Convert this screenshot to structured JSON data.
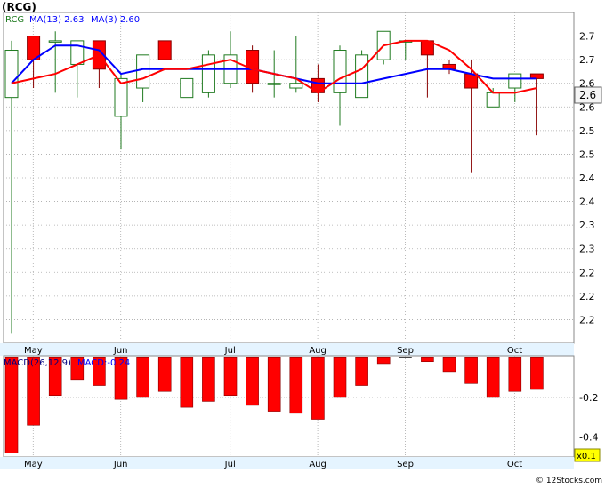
{
  "ticker_label": "(RCG)",
  "footer_credit": "© 12Stocks.com",
  "colors": {
    "up_fill": "#ffffff",
    "up_stroke": "#1f7a1f",
    "down_fill": "#ff0000",
    "down_stroke": "#880000",
    "ma13": "#0000ff",
    "ma3": "#ff0000",
    "macd_bar": "#ff0000",
    "grid": "#aaaaaa",
    "axis_band": "#e5f4ff",
    "price_tag_bg": "#f5f5f5",
    "multiplier_bg": "#ffff00"
  },
  "chart_data": [
    {
      "type": "candlestick",
      "title": "RCG",
      "legend": [
        "RCG",
        "MA(13)  2.63",
        "MA(3)  2.60"
      ],
      "ylim": [
        2.1,
        2.8
      ],
      "y_ticks": [
        {
          "value": 2.75,
          "label": "2.7"
        },
        {
          "value": 2.7,
          "label": "2.7"
        },
        {
          "value": 2.65,
          "label": "2.6"
        },
        {
          "value": 2.6,
          "label": "2.6"
        },
        {
          "value": 2.55,
          "label": "2.5"
        },
        {
          "value": 2.5,
          "label": "2.5"
        },
        {
          "value": 2.45,
          "label": "2.4"
        },
        {
          "value": 2.4,
          "label": "2.4"
        },
        {
          "value": 2.35,
          "label": "2.3"
        },
        {
          "value": 2.3,
          "label": "2.3"
        },
        {
          "value": 2.25,
          "label": "2.2"
        },
        {
          "value": 2.2,
          "label": "2.2"
        },
        {
          "value": 2.15,
          "label": "2.2"
        }
      ],
      "x_ticks": [
        {
          "index": 1,
          "label": "May"
        },
        {
          "index": 5,
          "label": "Jun"
        },
        {
          "index": 10,
          "label": "Jul"
        },
        {
          "index": 14,
          "label": "Aug"
        },
        {
          "index": 18,
          "label": "Sep"
        },
        {
          "index": 23,
          "label": "Oct"
        }
      ],
      "last_price_label": "2.6",
      "last_price": 2.625,
      "candles": [
        {
          "o": 2.62,
          "h": 2.74,
          "l": 2.12,
          "c": 2.72
        },
        {
          "o": 2.75,
          "h": 2.75,
          "l": 2.64,
          "c": 2.7
        },
        {
          "o": 2.74,
          "h": 2.76,
          "l": 2.63,
          "c": 2.74
        },
        {
          "o": 2.69,
          "h": 2.74,
          "l": 2.62,
          "c": 2.74
        },
        {
          "o": 2.74,
          "h": 2.74,
          "l": 2.64,
          "c": 2.68
        },
        {
          "o": 2.58,
          "h": 2.67,
          "l": 2.51,
          "c": 2.66
        },
        {
          "o": 2.64,
          "h": 2.71,
          "l": 2.61,
          "c": 2.71
        },
        {
          "o": 2.74,
          "h": 2.74,
          "l": 2.7,
          "c": 2.7
        },
        {
          "o": 2.62,
          "h": 2.66,
          "l": 2.62,
          "c": 2.66
        },
        {
          "o": 2.63,
          "h": 2.72,
          "l": 2.62,
          "c": 2.71
        },
        {
          "o": 2.65,
          "h": 2.76,
          "l": 2.64,
          "c": 2.71
        },
        {
          "o": 2.72,
          "h": 2.73,
          "l": 2.63,
          "c": 2.65
        },
        {
          "o": 2.65,
          "h": 2.72,
          "l": 2.62,
          "c": 2.65
        },
        {
          "o": 2.64,
          "h": 2.75,
          "l": 2.63,
          "c": 2.65
        },
        {
          "o": 2.66,
          "h": 2.69,
          "l": 2.61,
          "c": 2.63
        },
        {
          "o": 2.63,
          "h": 2.73,
          "l": 2.56,
          "c": 2.72
        },
        {
          "o": 2.62,
          "h": 2.72,
          "l": 2.62,
          "c": 2.71
        },
        {
          "o": 2.7,
          "h": 2.76,
          "l": 2.69,
          "c": 2.76
        },
        {
          "o": 2.74,
          "h": 2.74,
          "l": 2.7,
          "c": 2.74
        },
        {
          "o": 2.74,
          "h": 2.74,
          "l": 2.62,
          "c": 2.71
        },
        {
          "o": 2.69,
          "h": 2.7,
          "l": 2.67,
          "c": 2.68
        },
        {
          "o": 2.67,
          "h": 2.7,
          "l": 2.46,
          "c": 2.64
        },
        {
          "o": 2.6,
          "h": 2.64,
          "l": 2.6,
          "c": 2.63
        },
        {
          "o": 2.64,
          "h": 2.67,
          "l": 2.61,
          "c": 2.67
        },
        {
          "o": 2.67,
          "h": 2.67,
          "l": 2.54,
          "c": 2.66
        }
      ],
      "series": [
        {
          "name": "MA(13)",
          "color_key": "ma13",
          "values": [
            2.65,
            2.7,
            2.73,
            2.73,
            2.72,
            2.67,
            2.68,
            2.68,
            2.68,
            2.68,
            2.68,
            2.68,
            2.67,
            2.66,
            2.65,
            2.65,
            2.65,
            2.66,
            2.67,
            2.68,
            2.68,
            2.67,
            2.66,
            2.66,
            2.66
          ]
        },
        {
          "name": "MA(3)",
          "color_key": "ma3",
          "values": [
            2.65,
            2.66,
            2.67,
            2.69,
            2.71,
            2.65,
            2.66,
            2.68,
            2.68,
            2.69,
            2.7,
            2.68,
            2.67,
            2.66,
            2.63,
            2.66,
            2.68,
            2.73,
            2.74,
            2.74,
            2.72,
            2.68,
            2.63,
            2.63,
            2.64
          ]
        }
      ]
    },
    {
      "type": "bar",
      "title": "MACD(26,12,9)",
      "legend": [
        "MACD(26,12,9)",
        "MACD:-0.24"
      ],
      "multiplier_label": "x0.1",
      "ylim": [
        -0.5,
        0.01
      ],
      "y_ticks": [
        {
          "value": -0.2,
          "label": "-0.2"
        },
        {
          "value": -0.4,
          "label": "-0.4"
        }
      ],
      "values": [
        -0.48,
        -0.34,
        -0.19,
        -0.11,
        -0.14,
        -0.21,
        -0.2,
        -0.17,
        -0.25,
        -0.22,
        -0.19,
        -0.24,
        -0.27,
        -0.28,
        -0.31,
        -0.2,
        -0.14,
        -0.03,
        0.0,
        -0.02,
        -0.07,
        -0.13,
        -0.2,
        -0.17,
        -0.16
      ]
    }
  ]
}
